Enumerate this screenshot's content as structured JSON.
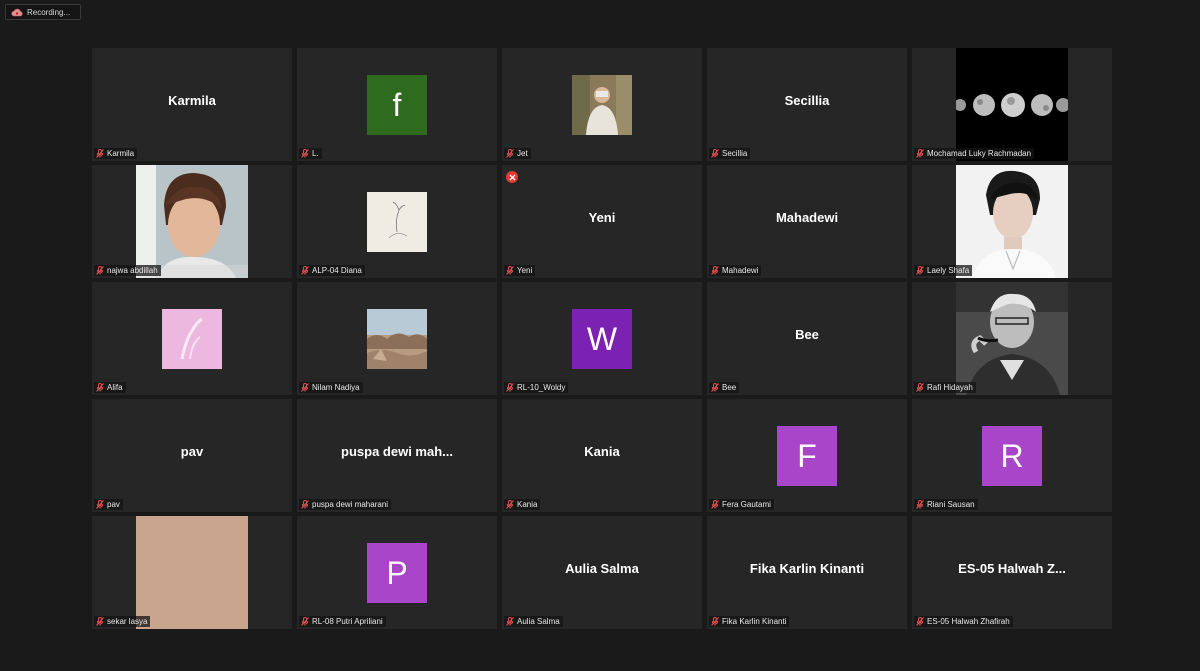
{
  "recording": {
    "label": "Recording..."
  },
  "tiles": [
    {
      "name": "Karmila",
      "display": "Karmila",
      "kind": "text"
    },
    {
      "name": "L.",
      "kind": "initial",
      "initial": "f",
      "color": "#2f6b1f"
    },
    {
      "name": "Jet",
      "kind": "photo",
      "photo": "jet"
    },
    {
      "name": "Secillia",
      "display": "Secillia",
      "kind": "text"
    },
    {
      "name": "Mochamad Luky Rachmadan",
      "kind": "big",
      "photo": "moon"
    },
    {
      "name": "najwa abdillah",
      "kind": "big",
      "photo": "portrait-warm"
    },
    {
      "name": "ALP-04 Diana",
      "kind": "photo",
      "photo": "sketch"
    },
    {
      "name": "Yeni",
      "display": "Yeni",
      "kind": "text",
      "alert": true
    },
    {
      "name": "Mahadewi",
      "display": "Mahadewi",
      "kind": "text"
    },
    {
      "name": "Laely Shafa",
      "kind": "big",
      "photo": "portrait-white"
    },
    {
      "name": "Alifa",
      "kind": "photo",
      "photo": "pink"
    },
    {
      "name": "Nilam Nadiya",
      "kind": "photo",
      "photo": "desert"
    },
    {
      "name": "RL-10_Woldy",
      "kind": "initial",
      "initial": "W",
      "color": "#7b22b3"
    },
    {
      "name": "Bee",
      "display": "Bee",
      "kind": "text"
    },
    {
      "name": "Rafi Hidayah",
      "kind": "big",
      "photo": "bw-portrait"
    },
    {
      "name": "pav",
      "display": "pav",
      "kind": "text"
    },
    {
      "name": "puspa dewi maharani",
      "display": "puspa dewi mah...",
      "kind": "text"
    },
    {
      "name": "Kania",
      "display": "Kania",
      "kind": "text"
    },
    {
      "name": "Fera Gautami",
      "kind": "initial",
      "initial": "F",
      "color": "#a945c9"
    },
    {
      "name": "Riani Sausan",
      "kind": "initial",
      "initial": "R",
      "color": "#a945c9"
    },
    {
      "name": "sekar lasya",
      "kind": "big",
      "photo": "beige"
    },
    {
      "name": "RL-08 Putri Apriliani",
      "kind": "initial",
      "initial": "P",
      "color": "#a945c9"
    },
    {
      "name": "Aulia Salma",
      "display": "Aulia Salma",
      "kind": "text"
    },
    {
      "name": "Fika Karlin Kinanti",
      "display": "Fika Karlin Kinanti",
      "kind": "text"
    },
    {
      "name": "ES-05 Halwah Zhafirah",
      "display": "ES-05  Halwah Z...",
      "kind": "text"
    }
  ]
}
